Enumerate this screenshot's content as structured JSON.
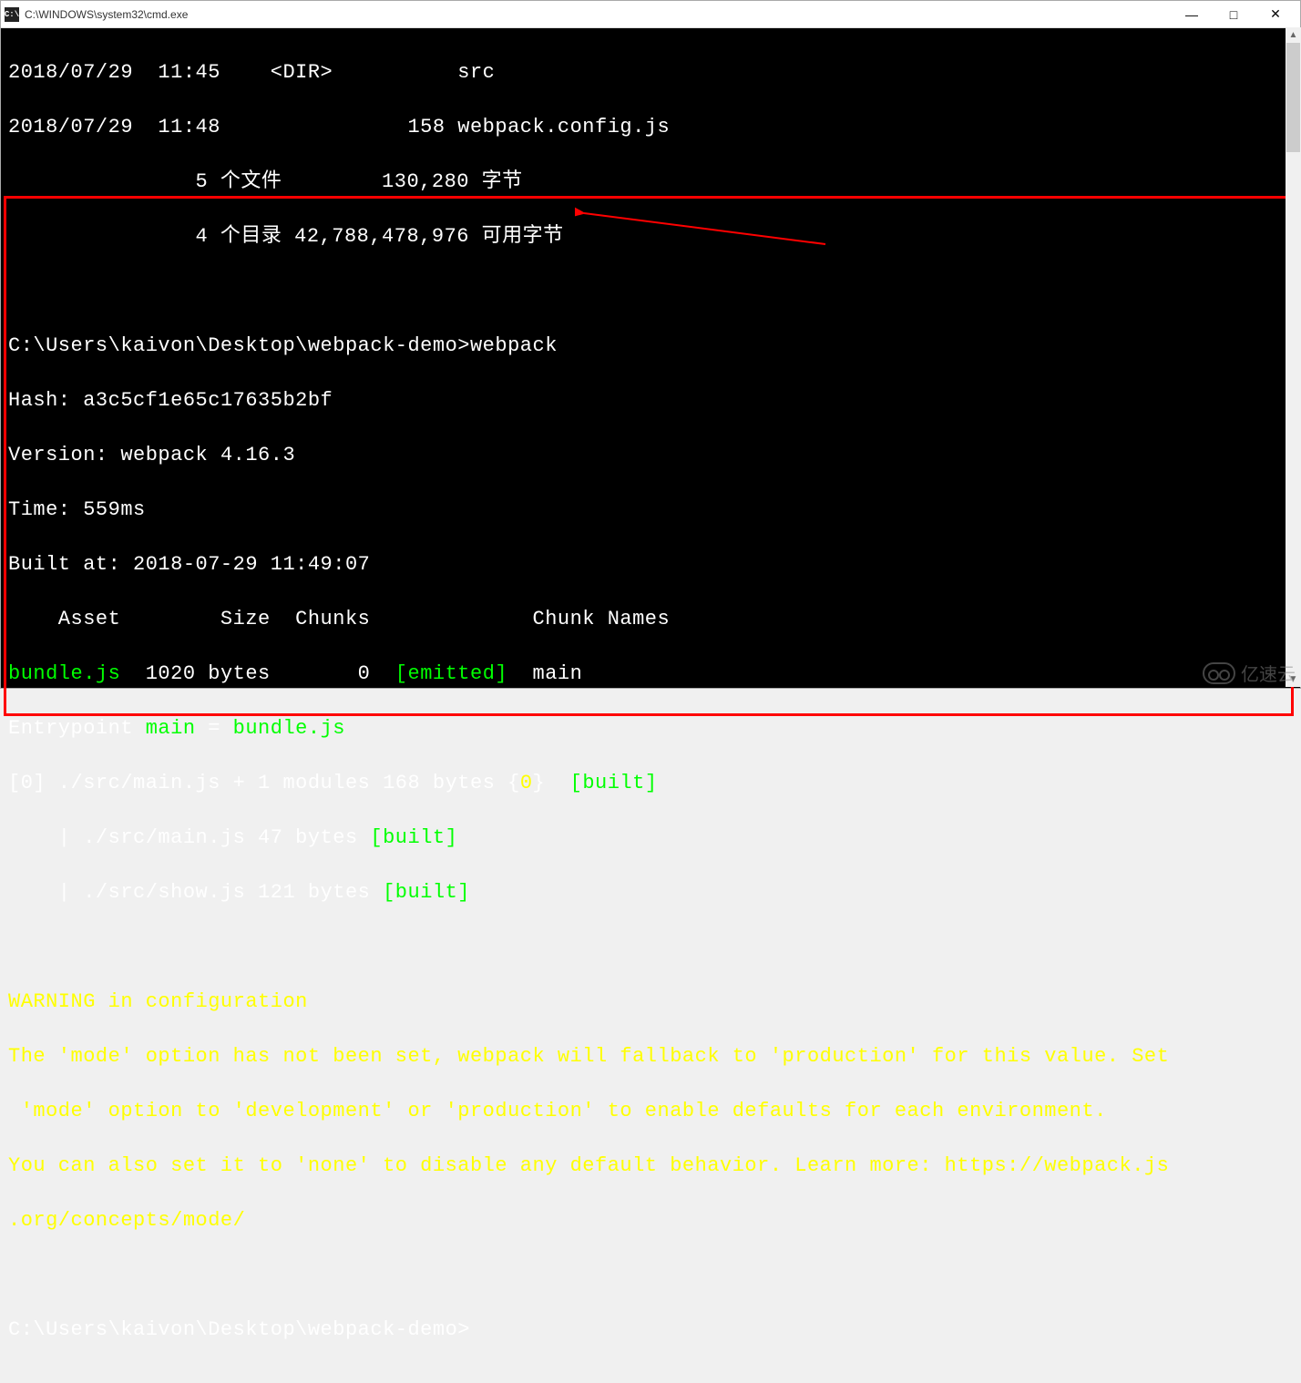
{
  "window": {
    "title": "C:\\WINDOWS\\system32\\cmd.exe",
    "icon_label": "C:\\",
    "controls": {
      "minimize": "—",
      "maximize": "□",
      "close": "✕"
    }
  },
  "dir_listing": {
    "line1": "2018/07/29  11:45    <DIR>          src",
    "line2": "2018/07/29  11:48               158 webpack.config.js",
    "summary_files": "               5 个文件        130,280 字节",
    "summary_dirs": "               4 个目录 42,788,478,976 可用字节"
  },
  "cmd": {
    "prompt_path": "C:\\Users\\kaivon\\Desktop\\webpack-demo>",
    "command": "webpack"
  },
  "webpack": {
    "hash_label": "Hash: ",
    "hash": "a3c5cf1e65c17635b2bf",
    "version_label": "Version: webpack ",
    "version": "4.16.3",
    "time_label": "Time: ",
    "time": "559ms",
    "built_at_label": "Built at: 2018-07-29 ",
    "built_at_time": "11:49:07",
    "header": "    Asset        Size  Chunks             Chunk Names",
    "row": {
      "asset": "bundle.js",
      "size": "  1020 bytes",
      "chunks": "       0",
      "emitted": "  [emitted]",
      "name": "  main"
    },
    "entry_prefix": "Entrypoint ",
    "entry_main": "main",
    "entry_eq": " = ",
    "entry_bundle": "bundle.js",
    "mod0_idx": "[0]",
    "mod0_file": " ./src/main.js + 1 modules",
    "mod0_size": " 168 bytes",
    "mod0_brace_open": " {",
    "mod0_zero": "0",
    "mod0_brace_close": "} ",
    "mod0_built": " [built]",
    "mod1_prefix": "    | ",
    "mod1_file": "./src/main.js",
    "mod1_size": " 47 bytes",
    "mod1_built": " [built]",
    "mod2_prefix": "    | ",
    "mod2_file": "./src/show.js",
    "mod2_size": " 121 bytes",
    "mod2_built": " [built]"
  },
  "warning": {
    "title": "WARNING in configuration",
    "line1": "The 'mode' option has not been set, webpack will fallback to 'production' for this value. Set",
    "line2": " 'mode' option to 'development' or 'production' to enable defaults for each environment.",
    "line3": "You can also set it to 'none' to disable any default behavior. Learn more: https://webpack.js",
    "line4": ".org/concepts/mode/"
  },
  "prompt2": "C:\\Users\\kaivon\\Desktop\\webpack-demo>",
  "watermark": "亿速云"
}
